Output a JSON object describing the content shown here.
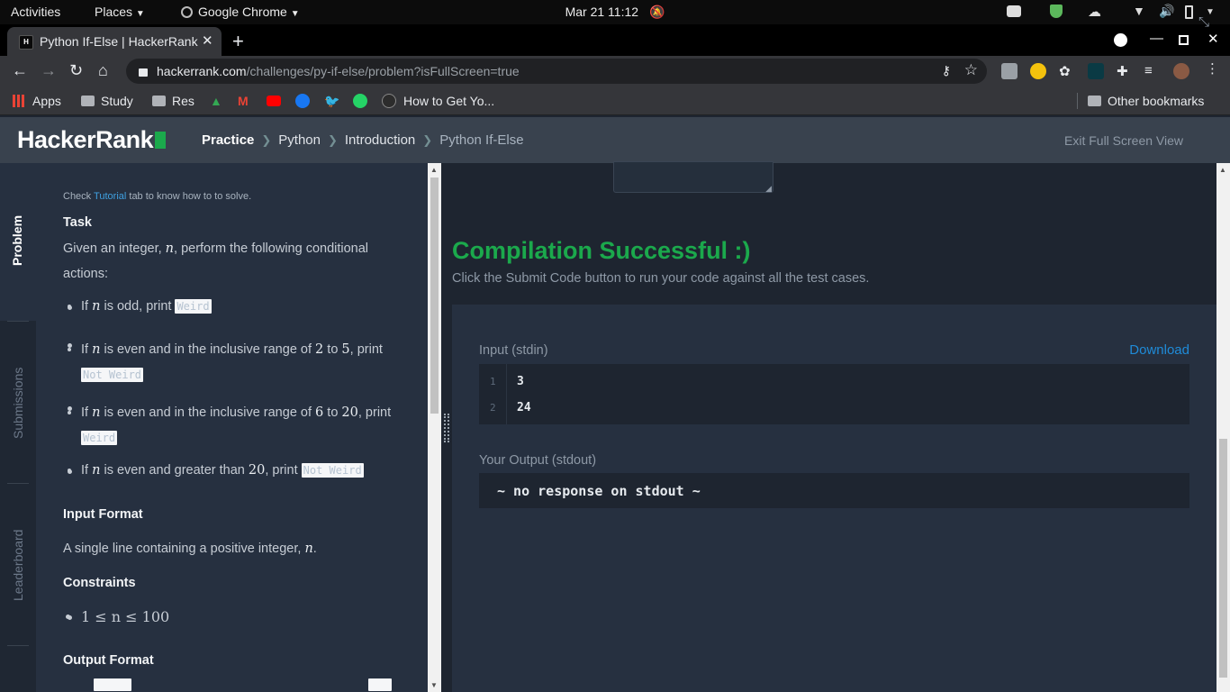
{
  "topbar": {
    "activities": "Activities",
    "places": "Places",
    "app": "Google Chrome",
    "datetime": "Mar 21  11:12"
  },
  "browser": {
    "tab_title": "Python If-Else | HackerRank",
    "favicon_text": "H",
    "url_host": "hackerrank.com",
    "url_path": "/challenges/py-if-else/problem?isFullScreen=true"
  },
  "bookmarks": {
    "apps": "Apps",
    "study": "Study",
    "res": "Res",
    "howto": "How to Get Yo...",
    "other": "Other bookmarks"
  },
  "header": {
    "logo": "HackerRank",
    "crumbs": [
      "Practice",
      "Python",
      "Introduction",
      "Python If-Else"
    ],
    "exit_full_screen": "Exit Full Screen View"
  },
  "rail": {
    "tabs": [
      "Problem",
      "Submissions",
      "Leaderboard"
    ]
  },
  "problem": {
    "note_pre": "Check ",
    "note_link": "Tutorial",
    "note_post": " tab to know how to to solve.",
    "task_heading": "Task",
    "task_text_a": "Given an integer, ",
    "task_var": "n",
    "task_text_b": ", perform the following conditional",
    "task_text_c": "actions:",
    "b1_a": "If ",
    "b1_var": "n",
    "b1_b": " is odd, print ",
    "b1_code": "Weird",
    "b2_a": "If ",
    "b2_var": "n",
    "b2_b": " is even and in the inclusive range of ",
    "b2_n1": "2",
    "b2_c": " to ",
    "b2_n2": "5",
    "b2_d": ", print",
    "b2_code": "Not Weird",
    "b3_a": "If ",
    "b3_var": "n",
    "b3_b": " is even and in the inclusive range of ",
    "b3_n1": "6",
    "b3_c": " to ",
    "b3_n2": "20",
    "b3_d": ", print",
    "b3_code": "Weird",
    "b4_a": "If ",
    "b4_var": "n",
    "b4_b": " is even and greater than ",
    "b4_n": "20",
    "b4_c": ", print ",
    "b4_code": "Not Weird",
    "input_heading": "Input Format",
    "input_text": "A single line containing a positive integer, ",
    "input_var": "n",
    "input_end": ".",
    "constraints_heading": "Constraints",
    "constraint": "1 ≤ n ≤ 100",
    "output_heading": "Output Format"
  },
  "results": {
    "title": "Compilation Successful :)",
    "hint": "Click the Submit Code button to run your code against all the test cases.",
    "input_label": "Input (stdin)",
    "download": "Download",
    "input_lines": [
      {
        "num": "1",
        "text": "3"
      },
      {
        "num": "2",
        "text": "24"
      }
    ],
    "output_label": "Your Output (stdout)",
    "output_text": "~ no response on stdout ~"
  }
}
